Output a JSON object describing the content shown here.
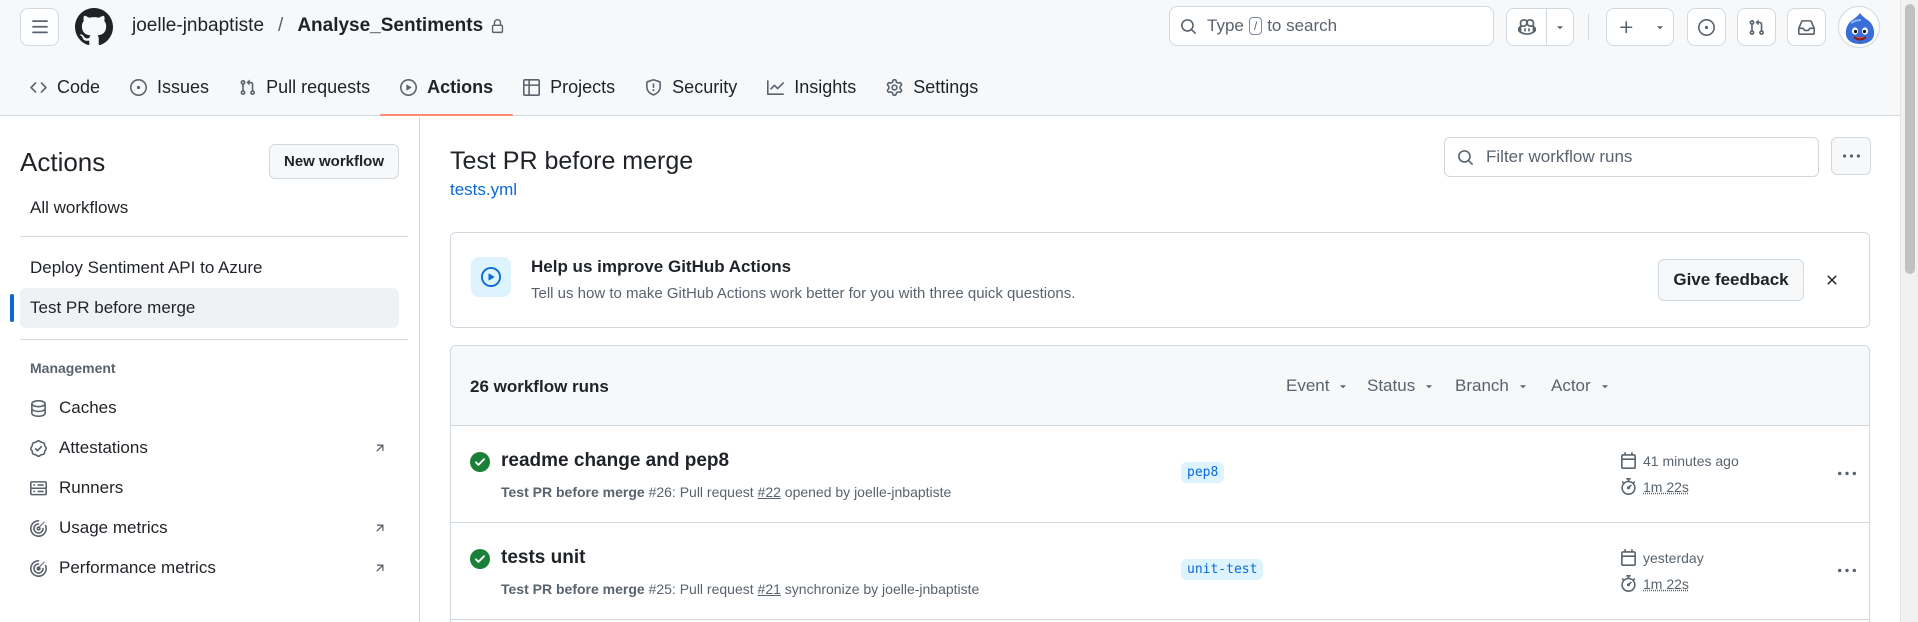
{
  "header": {
    "owner": "joelle-jnbaptiste",
    "separator": "/",
    "repo": "Analyse_Sentiments",
    "search": {
      "prefix": "Type",
      "key": "/",
      "suffix": "to search"
    }
  },
  "tabs": [
    {
      "label": "Code",
      "icon": "code-icon"
    },
    {
      "label": "Issues",
      "icon": "issue-opened-icon"
    },
    {
      "label": "Pull requests",
      "icon": "git-pull-request-icon"
    },
    {
      "label": "Actions",
      "icon": "play-icon",
      "active": true
    },
    {
      "label": "Projects",
      "icon": "table-icon"
    },
    {
      "label": "Security",
      "icon": "shield-icon"
    },
    {
      "label": "Insights",
      "icon": "graph-icon"
    },
    {
      "label": "Settings",
      "icon": "gear-icon"
    }
  ],
  "sidebar": {
    "title": "Actions",
    "new_workflow": "New workflow",
    "all_workflows": "All workflows",
    "workflows": [
      {
        "label": "Deploy Sentiment API to Azure"
      },
      {
        "label": "Test PR before merge",
        "selected": true
      }
    ],
    "management_heading": "Management",
    "management": [
      {
        "label": "Caches",
        "icon": "database-icon",
        "external": false
      },
      {
        "label": "Attestations",
        "icon": "verified-icon",
        "external": true
      },
      {
        "label": "Runners",
        "icon": "server-icon",
        "external": false
      },
      {
        "label": "Usage metrics",
        "icon": "meter-icon",
        "external": true
      },
      {
        "label": "Performance metrics",
        "icon": "stopwatch-icon",
        "external": true
      }
    ]
  },
  "main": {
    "title": "Test PR before merge",
    "file": "tests.yml",
    "filter_placeholder": "Filter workflow runs",
    "feedback": {
      "title": "Help us improve GitHub Actions",
      "description": "Tell us how to make GitHub Actions work better for you with three quick questions.",
      "button": "Give feedback"
    },
    "runs": {
      "count_label": "26 workflow runs",
      "filters": [
        "Event",
        "Status",
        "Branch",
        "Actor"
      ],
      "items": [
        {
          "title": "readme change and pep8",
          "workflow": "Test PR before merge",
          "run": "#26",
          "trigger_prefix": ": Pull request",
          "pr": "#22",
          "action": "opened by joelle-jnbaptiste",
          "branch": "pep8",
          "when": "41 minutes ago",
          "duration": "1m 22s",
          "status": "success"
        },
        {
          "title": "tests unit",
          "workflow": "Test PR before merge",
          "run": "#25",
          "trigger_prefix": ": Pull request",
          "pr": "#21",
          "action": "synchronize by joelle-jnbaptiste",
          "branch": "unit-test",
          "when": "yesterday",
          "duration": "1m 22s",
          "status": "success"
        }
      ]
    }
  },
  "colors": {
    "accent": "#0969da",
    "success": "#1a7f37",
    "active_tab_underline": "#fd8c73"
  }
}
